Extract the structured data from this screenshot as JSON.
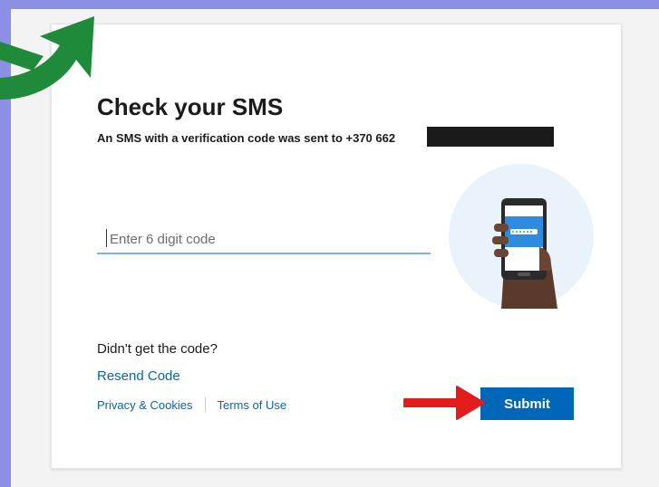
{
  "dialog": {
    "title": "Check your SMS",
    "subtitle": "An SMS with a verification code was sent to +370 662",
    "code_placeholder": "Enter 6 digit code",
    "didnt_get_label": "Didn't get the code?",
    "resend_label": "Resend Code",
    "privacy_label": "Privacy & Cookies",
    "terms_label": "Terms of Use",
    "submit_label": "Submit"
  },
  "colors": {
    "page_background": "#8b8fe6",
    "accent": "#0067b8",
    "input_underline": "#7fb2e5",
    "annotation_green": "#1f8a3a",
    "annotation_red": "#e21b1b"
  },
  "icons": {
    "illustration": "phone-in-hand-icon",
    "green_annotation": "green-arrow-icon",
    "red_annotation": "red-arrow-icon"
  }
}
